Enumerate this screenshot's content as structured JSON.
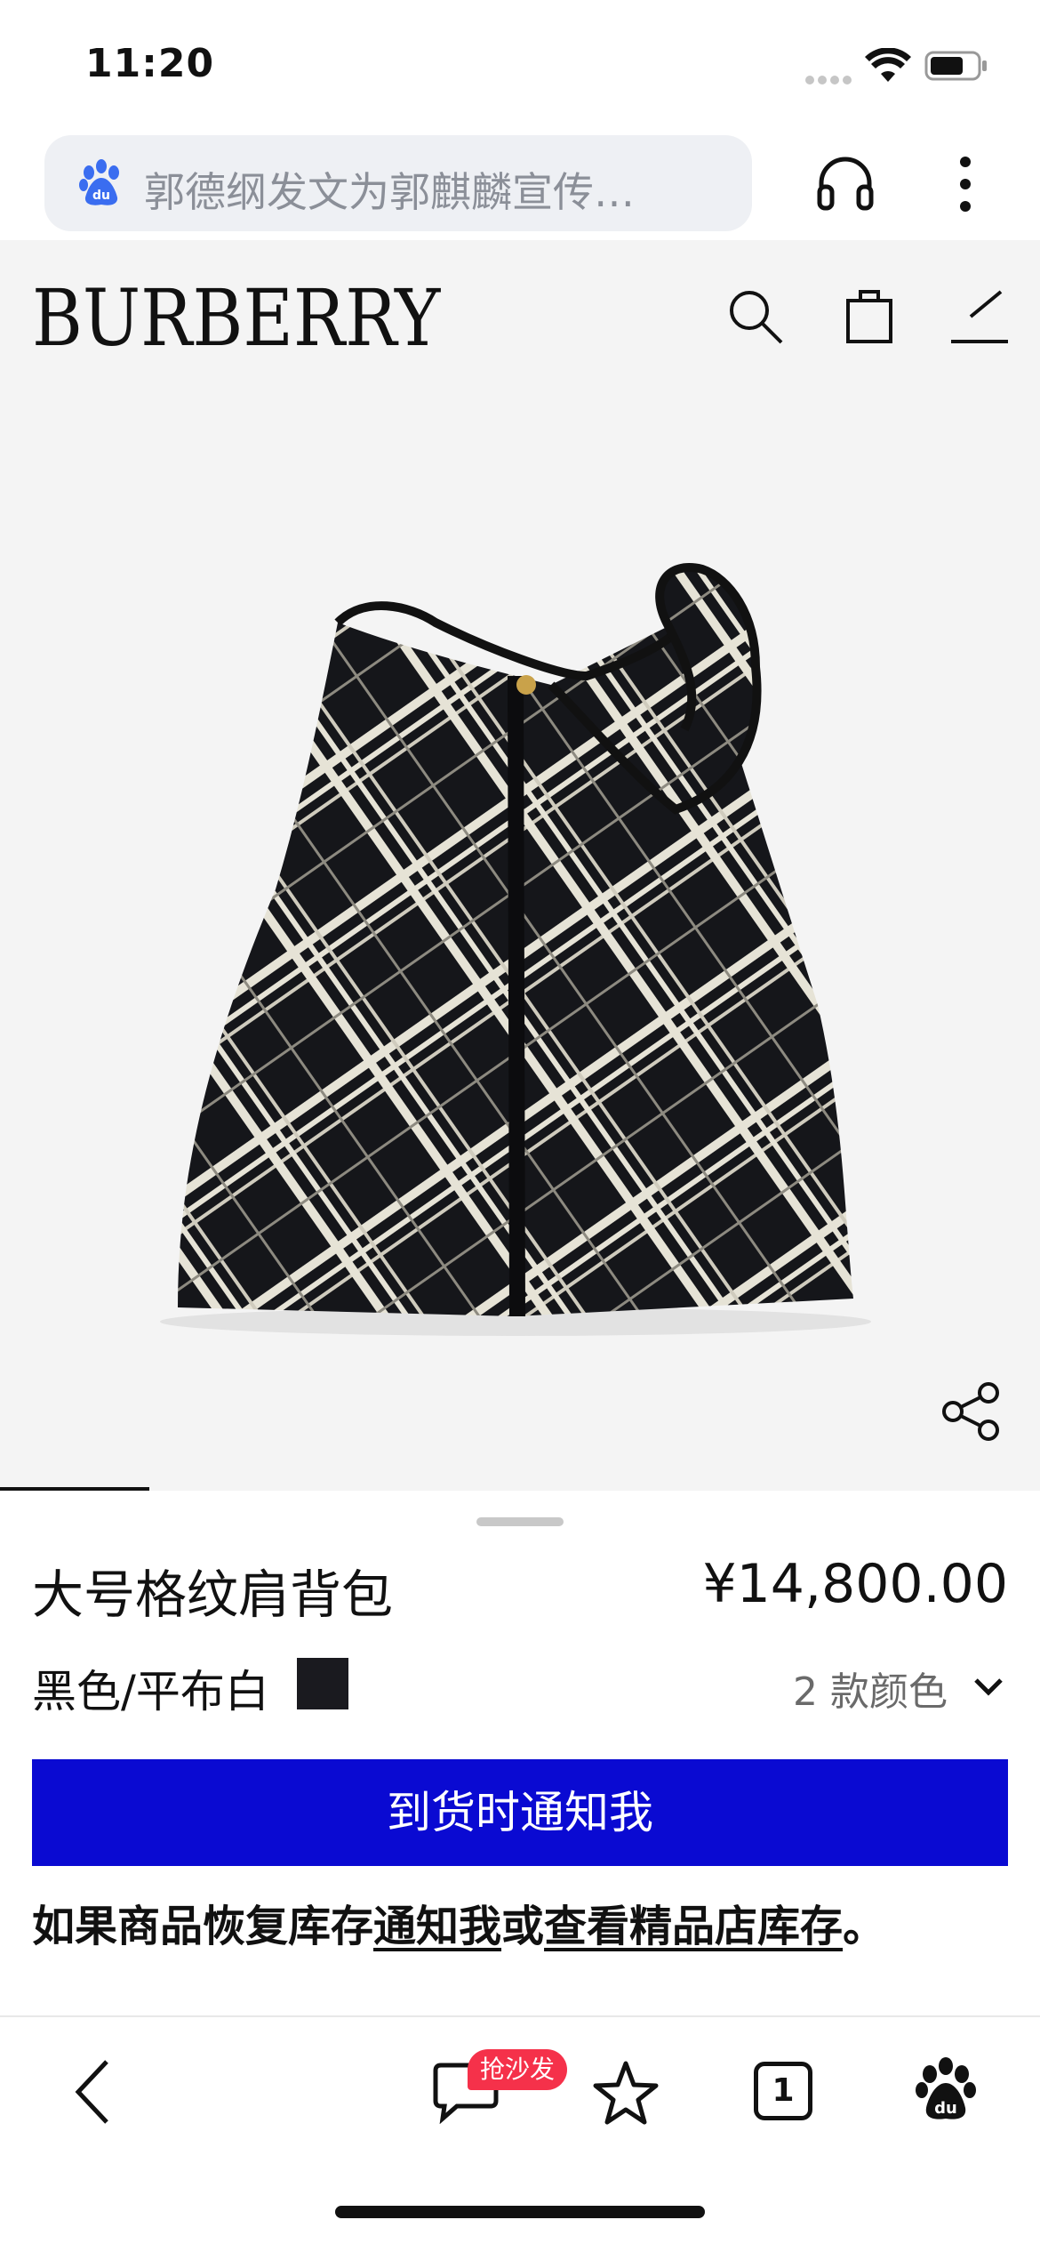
{
  "status_bar": {
    "time": "11:20"
  },
  "browser": {
    "address_text": "郭德纲发文为郭麒麟宣传…"
  },
  "site": {
    "brand": "BURBERRY"
  },
  "product": {
    "name": "大号格纹肩背包",
    "price": "¥14,800.00",
    "color_label": "黑色/平布白",
    "color_swatch": "#1a1a1f",
    "color_count": "2 款颜色",
    "notify_label": "到货时通知我",
    "restock": {
      "prefix": "如果商品恢复库存",
      "link_notify": "通知我",
      "middle": "或",
      "link_store": "查看精品店库存",
      "suffix": "。"
    }
  },
  "toolbar": {
    "sofa_badge": "抢沙发",
    "tab_count": "1"
  },
  "colors": {
    "accent_button": "#0a0ad2",
    "badge": "#f5314a",
    "stage_background": "#f4f4f4"
  }
}
